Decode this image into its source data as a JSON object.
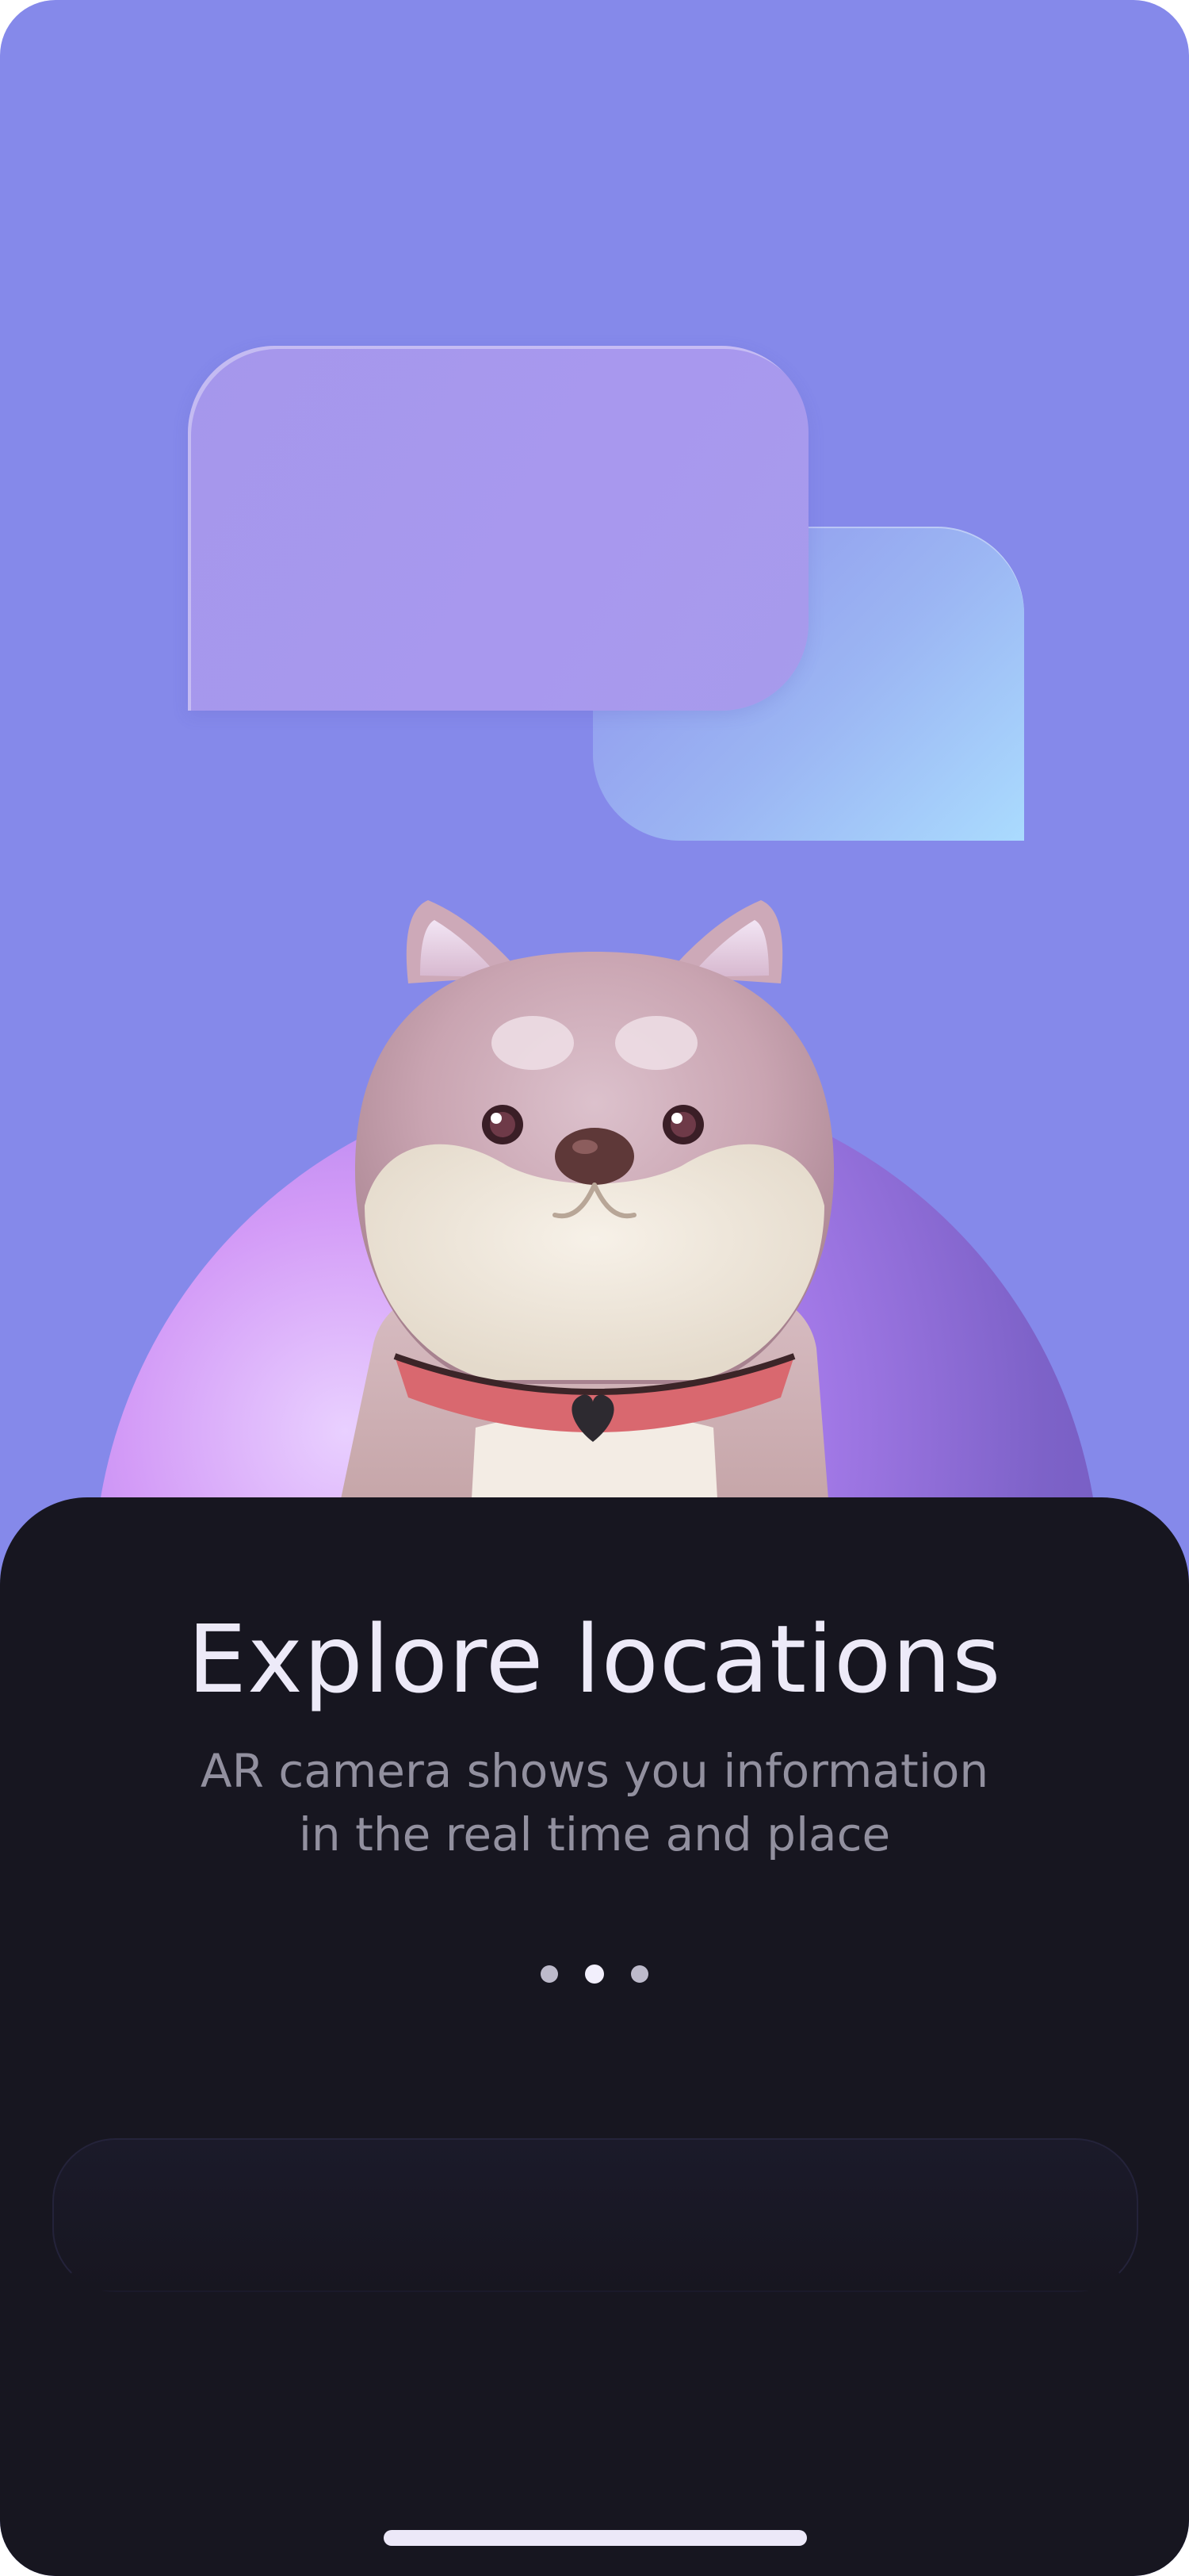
{
  "onboarding": {
    "title": "Explore locations",
    "subtitle_line1": "AR camera shows you information",
    "subtitle_line2": "in the real time and place",
    "page_indicator": {
      "total": 3,
      "current": 2
    }
  },
  "colors": {
    "background": "#8589EA",
    "sheet": "#171620",
    "title": "#EDEAF8",
    "subtitle": "#92909F",
    "bubble_front": "#A898EE",
    "bubble_back_start": "#8E92EC",
    "bubble_back_end": "#AADBFE",
    "dog_collar": "#D9686F"
  },
  "icons": {
    "illustration": "dog-mascot-icon",
    "bubbles": "chat-bubbles-icon"
  }
}
